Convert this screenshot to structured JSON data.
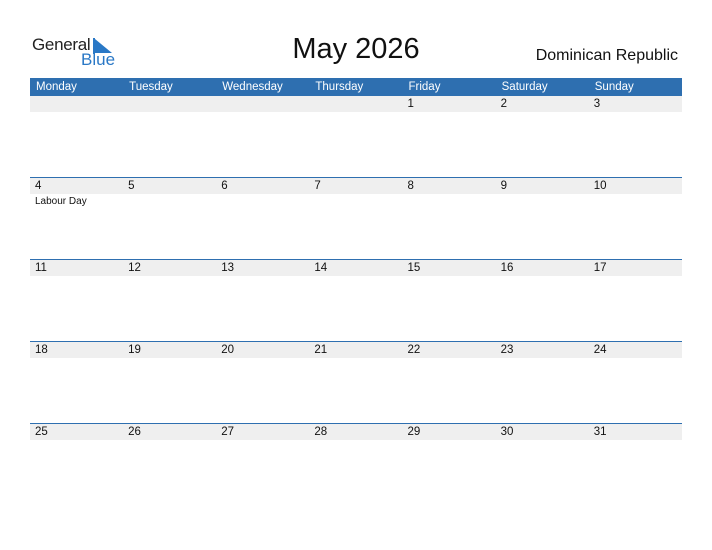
{
  "logo": {
    "word1": "General",
    "word2": "Blue"
  },
  "title": "May 2026",
  "country": "Dominican Republic",
  "colors": {
    "header_bg": "#2e6fb0",
    "logo_blue": "#2a78c6",
    "day_strip": "#efefef"
  },
  "weekdays": [
    "Monday",
    "Tuesday",
    "Wednesday",
    "Thursday",
    "Friday",
    "Saturday",
    "Sunday"
  ],
  "weeks": [
    {
      "days": [
        "",
        "",
        "",
        "",
        "1",
        "2",
        "3"
      ],
      "events": [
        "",
        "",
        "",
        "",
        "",
        "",
        ""
      ]
    },
    {
      "days": [
        "4",
        "5",
        "6",
        "7",
        "8",
        "9",
        "10"
      ],
      "events": [
        "Labour Day",
        "",
        "",
        "",
        "",
        "",
        ""
      ]
    },
    {
      "days": [
        "11",
        "12",
        "13",
        "14",
        "15",
        "16",
        "17"
      ],
      "events": [
        "",
        "",
        "",
        "",
        "",
        "",
        ""
      ]
    },
    {
      "days": [
        "18",
        "19",
        "20",
        "21",
        "22",
        "23",
        "24"
      ],
      "events": [
        "",
        "",
        "",
        "",
        "",
        "",
        ""
      ]
    },
    {
      "days": [
        "25",
        "26",
        "27",
        "28",
        "29",
        "30",
        "31"
      ],
      "events": [
        "",
        "",
        "",
        "",
        "",
        "",
        ""
      ]
    }
  ]
}
